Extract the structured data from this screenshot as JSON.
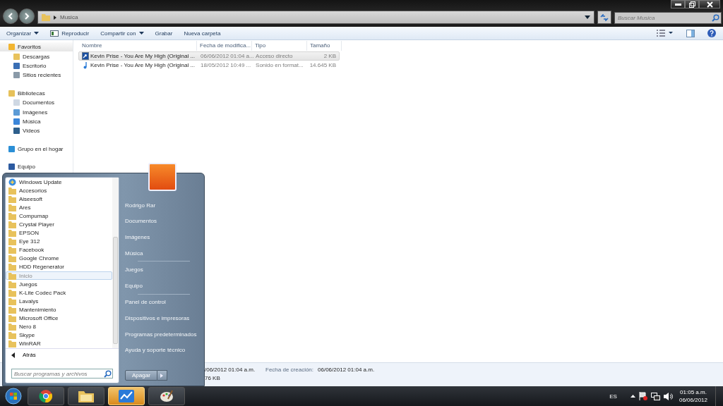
{
  "window": {
    "breadcrumb": "Musica",
    "search": {
      "placeholder": "Buscar Musica"
    }
  },
  "toolbar": {
    "buttons": [
      {
        "label": "Organizar",
        "kind": "menu"
      },
      {
        "label": "Reproducir",
        "kind": "play"
      },
      {
        "label": "Compartir con",
        "kind": "menu"
      },
      {
        "label": "Grabar",
        "kind": "plain"
      },
      {
        "label": "Nueva carpeta",
        "kind": "plain"
      }
    ]
  },
  "sidebar": {
    "groups": [
      {
        "label": "Favoritos",
        "selected": true,
        "children": [
          {
            "label": "Descargas"
          },
          {
            "label": "Escritorio"
          },
          {
            "label": "Sitios recientes"
          }
        ]
      },
      {
        "label": "Bibliotecas",
        "selected": false,
        "children": [
          {
            "label": "Documentos"
          },
          {
            "label": "Imágenes"
          },
          {
            "label": "Música"
          },
          {
            "label": "Videos"
          }
        ]
      },
      {
        "label": "Grupo en el hogar",
        "selected": false
      },
      {
        "label": "Equipo",
        "selected": false
      }
    ]
  },
  "table": {
    "columns": [
      "Nombre",
      "Fecha de modifica...",
      "Tipo",
      "Tamaño"
    ],
    "rows": [
      {
        "kind": "shortcut",
        "selected": true,
        "cells": [
          "Kevin Prise - You Are My High (Original ...",
          "06/06/2012 01:04 a...",
          "Acceso directo",
          "2 KB"
        ]
      },
      {
        "kind": "audio",
        "selected": false,
        "cells": [
          "Kevin Prise - You Are My High (Original ...",
          "18/05/2012 10:49 ...",
          "Sonido en format...",
          "14.645 KB"
        ]
      }
    ]
  },
  "details": {
    "modified_value": "/06/2012 01:04 a.m.",
    "size_value": "76 KB",
    "created_label": "Fecha de creación:",
    "created_value": "06/06/2012 01:04 a.m."
  },
  "start_menu": {
    "programs": [
      {
        "label": "Windows Update",
        "kind": "app",
        "selected": false
      },
      {
        "label": "Accesorios",
        "kind": "folder",
        "selected": false
      },
      {
        "label": "Aiseesoft",
        "kind": "folder",
        "selected": false
      },
      {
        "label": "Ares",
        "kind": "folder",
        "selected": false
      },
      {
        "label": "Compumap",
        "kind": "folder",
        "selected": false
      },
      {
        "label": "Crystal Player",
        "kind": "folder",
        "selected": false
      },
      {
        "label": "EPSON",
        "kind": "folder",
        "selected": false
      },
      {
        "label": "Eye 312",
        "kind": "folder",
        "selected": false
      },
      {
        "label": "Facebook",
        "kind": "folder",
        "selected": false
      },
      {
        "label": "Google Chrome",
        "kind": "folder",
        "selected": false
      },
      {
        "label": "HDD Regenerator",
        "kind": "folder",
        "selected": false
      },
      {
        "label": "Inicio",
        "kind": "folder",
        "selected": true
      },
      {
        "label": "Juegos",
        "kind": "folder",
        "selected": false
      },
      {
        "label": "K-Lite Codec Pack",
        "kind": "folder",
        "selected": false
      },
      {
        "label": "Lavalys",
        "kind": "folder",
        "selected": false
      },
      {
        "label": "Mantenimiento",
        "kind": "folder",
        "selected": false
      },
      {
        "label": "Microsoft Office",
        "kind": "folder",
        "selected": false
      },
      {
        "label": "Nero 8",
        "kind": "folder",
        "selected": false
      },
      {
        "label": "Skype",
        "kind": "folder",
        "selected": false
      },
      {
        "label": "WinRAR",
        "kind": "folder",
        "selected": false
      }
    ],
    "back": "Atrás",
    "search": {
      "placeholder": "Buscar programas y archivos"
    },
    "places": [
      {
        "label": "Rodrigo Rar",
        "divider_after": false
      },
      {
        "label": "Documentos",
        "divider_after": false
      },
      {
        "label": "Imágenes",
        "divider_after": false
      },
      {
        "label": "Música",
        "divider_after": true
      },
      {
        "label": "Juegos",
        "divider_after": false
      },
      {
        "label": "Equipo",
        "divider_after": true
      },
      {
        "label": "Panel de control",
        "divider_after": false
      },
      {
        "label": "Dispositivos e impresoras",
        "divider_after": false
      },
      {
        "label": "Programas predeterminados",
        "divider_after": false
      },
      {
        "label": "Ayuda y soporte técnico",
        "divider_after": false
      }
    ],
    "shutdown": "Apagar"
  },
  "taskbar": {
    "apps": [
      {
        "kind": "browser",
        "active": false
      },
      {
        "kind": "folder",
        "active": false
      },
      {
        "kind": "chart",
        "active": true
      },
      {
        "kind": "paint",
        "active": false
      }
    ],
    "language": "ES",
    "time": "01:05 a.m.",
    "date": "06/06/2012"
  }
}
